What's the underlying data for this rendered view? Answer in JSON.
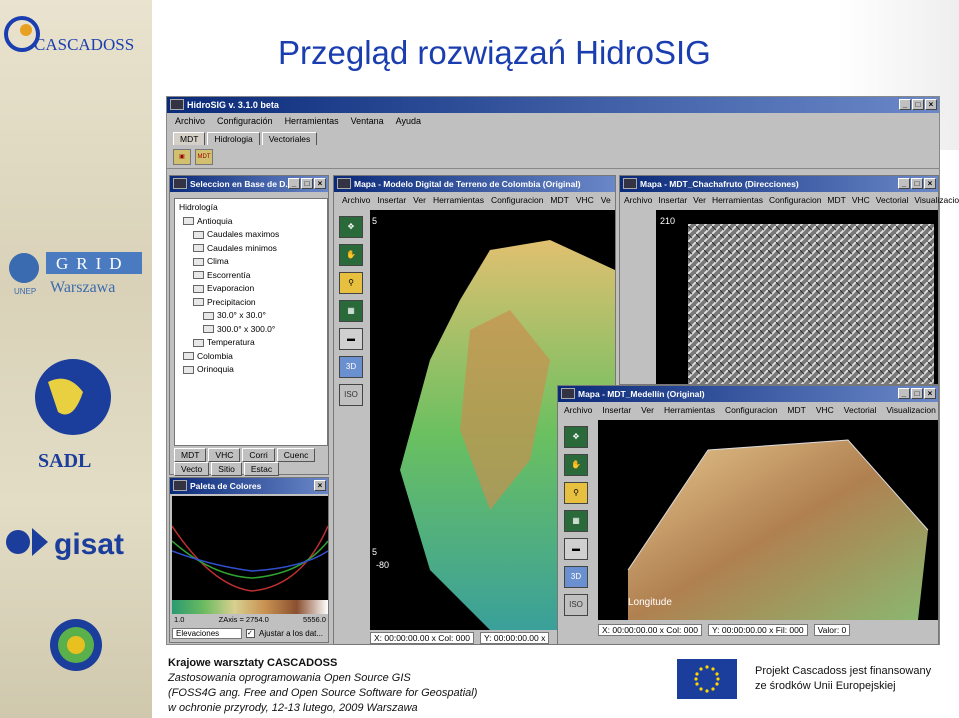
{
  "title": "Przegląd rozwiązań HidroSIG",
  "logos": {
    "cascadoss": "CASCADOSS",
    "grid": "GRID",
    "warszawa": "Warszawa",
    "unep": "UNEP",
    "sadl": "SADL",
    "gisat": "gisat"
  },
  "app": {
    "title": "HidroSIG v. 3.1.0 beta",
    "menu": [
      "Archivo",
      "Configuración",
      "Herramientas",
      "Ventana",
      "Ayuda"
    ],
    "tabs": [
      "MDT",
      "Hidrologia",
      "Vectoriales"
    ]
  },
  "seleccion": {
    "title": "Seleccion en Base de D...",
    "tree": [
      "Hidrología",
      "Antioquia",
      "Caudales maximos",
      "Caudales minimos",
      "Clima",
      "Escorrentía",
      "Evaporacion",
      "Precipitacion",
      "30.0° x 30.0°",
      "300.0° x 300.0°",
      "Temperatura",
      "Colombia",
      "Orinoquia"
    ],
    "tabs1": [
      "MDT",
      "VHC",
      "Corri",
      "Cuenc"
    ],
    "tabs2": [
      "Vecto",
      "Sitio",
      "Estac"
    ]
  },
  "paleta": {
    "title": "Paleta de Colores",
    "min": "1.0",
    "zaxis": "ZAxis = 2754.0",
    "max": "5556.0",
    "dropdown": "Elevaciones",
    "checkbox": "Ajustar a los dat..."
  },
  "mapa1": {
    "title": "Mapa - Modelo Digital de Terreno de Colombia (Original)",
    "menu": [
      "Archivo",
      "Insertar",
      "Ver",
      "Herramientas",
      "Configuracion",
      "MDT",
      "VHC",
      "Ve"
    ],
    "ylabel_top": "5",
    "ylabel_bottom": "5",
    "xlabel": "-80",
    "status_x": "X: 00:00:00.00 x Col: 000",
    "status_y": "Y: 00:00:00.00 x"
  },
  "mapa2": {
    "title": "Mapa - MDT_Chachafruto (Direcciones)",
    "menu": [
      "Archivo",
      "Insertar",
      "Ver",
      "Herramientas",
      "Configuracion",
      "MDT",
      "VHC",
      "Vectorial",
      "Visualizacio"
    ],
    "ylabel": "210"
  },
  "mapa3": {
    "title": "Mapa - MDT_Medellín (Original)",
    "menu": [
      "Archivo",
      "Insertar",
      "Ver",
      "Herramientas",
      "Configuracion",
      "MDT",
      "VHC",
      "Vectorial",
      "Visualizacion"
    ],
    "axis_label": "Longitude",
    "status_x": "X: 00:00:00.00 x Col: 000",
    "status_y": "Y: 00:00:00.00 x Fil: 000",
    "status_v": "Valor: 0"
  },
  "sidebar_buttons": [
    "3D",
    "ISO"
  ],
  "footer": {
    "l1": "Krajowe warsztaty CASCADOSS",
    "l2": "Zastosowania oprogramowania Open Source GIS",
    "l3": "(FOSS4G ang. Free and Open Source Software for Geospatial)",
    "l4": "w ochronie przyrody, 12-13 lutego, 2009 Warszawa"
  },
  "projekt": {
    "l1": "Projekt Cascadoss jest finansowany",
    "l2": "ze środków Unii Europejskiej"
  }
}
